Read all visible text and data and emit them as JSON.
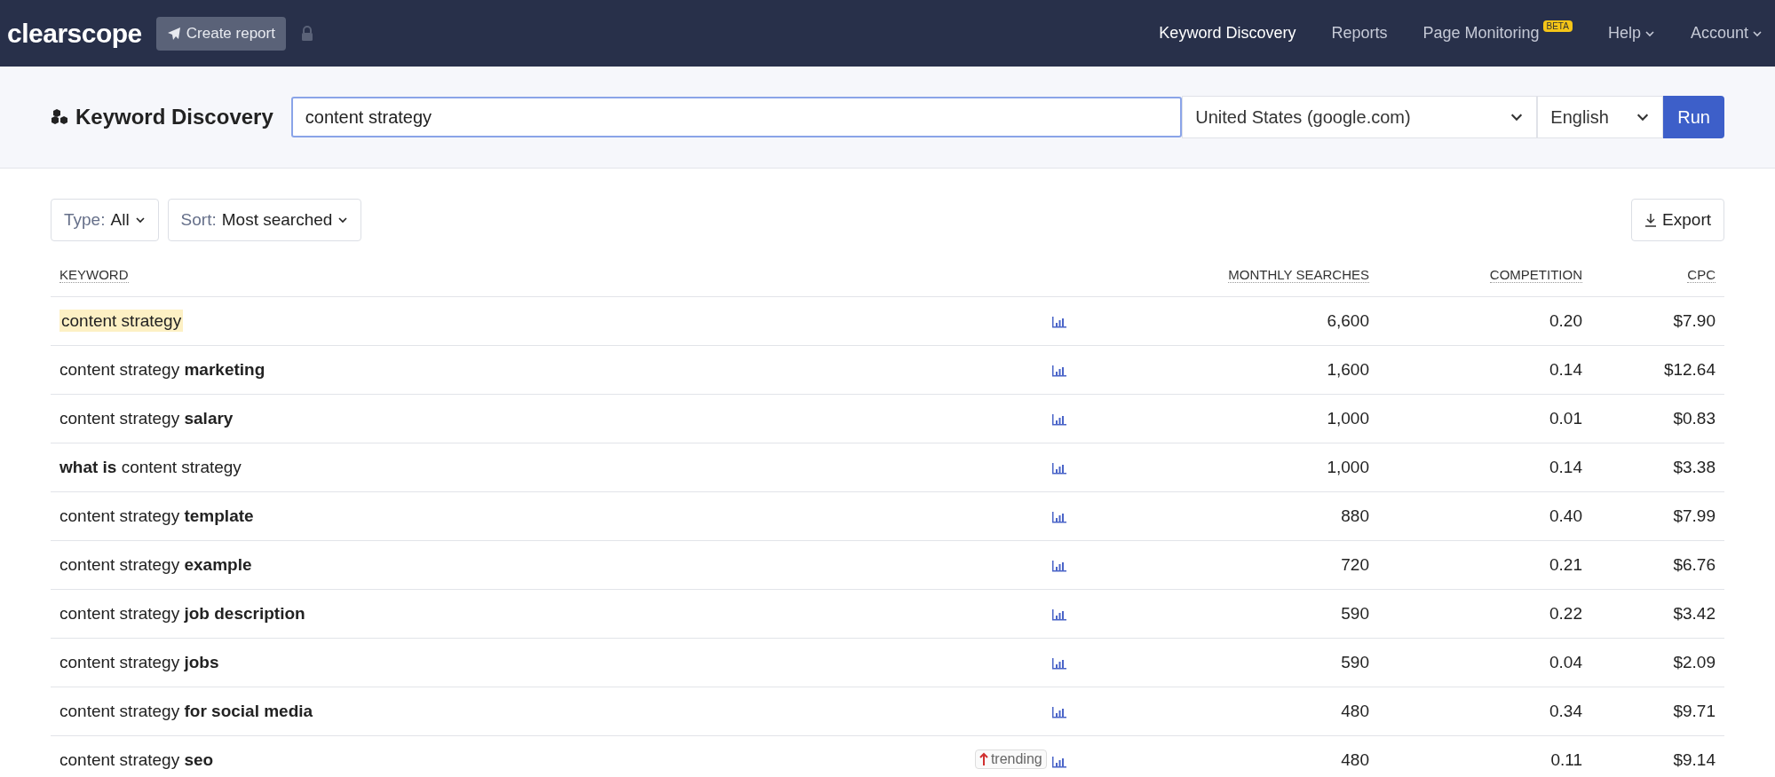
{
  "nav": {
    "logo": "clearscope",
    "create_button": "Create report",
    "links": [
      {
        "label": "Keyword Discovery",
        "selected": true,
        "kind": "link"
      },
      {
        "label": "Reports",
        "selected": false,
        "kind": "link"
      },
      {
        "label": "Page Monitoring",
        "selected": false,
        "kind": "link",
        "badge": "BETA"
      },
      {
        "label": "Help",
        "selected": false,
        "kind": "menu"
      },
      {
        "label": "Account",
        "selected": false,
        "kind": "menu"
      }
    ]
  },
  "search_bar": {
    "title": "Keyword Discovery",
    "query": "content strategy",
    "location": "United States (google.com)",
    "language": "English",
    "run_button": "Run"
  },
  "filters": [
    {
      "label": "Type:",
      "value": "All"
    },
    {
      "label": "Sort:",
      "value": "Most searched"
    }
  ],
  "export_button": "Export",
  "table": {
    "columns": [
      "KEYWORD",
      "MONTHLY SEARCHES",
      "COMPETITION",
      "CPC"
    ],
    "rows": [
      {
        "keyword": "content strategy",
        "highlighted": true,
        "searches": "6,600",
        "competition": "0.20",
        "cpc": "$7.90"
      },
      {
        "keyword": "content strategy **marketing**",
        "highlighted": false,
        "searches": "1,600",
        "competition": "0.14",
        "cpc": "$12.64"
      },
      {
        "keyword": "content strategy **salary**",
        "highlighted": false,
        "searches": "1,000",
        "competition": "0.01",
        "cpc": "$0.83"
      },
      {
        "keyword": "**what is** content strategy",
        "highlighted": false,
        "searches": "1,000",
        "competition": "0.14",
        "cpc": "$3.38"
      },
      {
        "keyword": "content strategy **template**",
        "highlighted": false,
        "searches": "880",
        "competition": "0.40",
        "cpc": "$7.99"
      },
      {
        "keyword": "content strategy **example**",
        "highlighted": false,
        "searches": "720",
        "competition": "0.21",
        "cpc": "$6.76"
      },
      {
        "keyword": "content strategy **job description**",
        "highlighted": false,
        "searches": "590",
        "competition": "0.22",
        "cpc": "$3.42"
      },
      {
        "keyword": "content strategy **jobs**",
        "highlighted": false,
        "searches": "590",
        "competition": "0.04",
        "cpc": "$2.09"
      },
      {
        "keyword": "content strategy **for social media**",
        "highlighted": false,
        "searches": "480",
        "competition": "0.34",
        "cpc": "$9.71"
      },
      {
        "keyword": "content strategy **seo**",
        "highlighted": false,
        "badge": "trending",
        "searches": "480",
        "competition": "0.11",
        "cpc": "$9.14"
      }
    ]
  }
}
